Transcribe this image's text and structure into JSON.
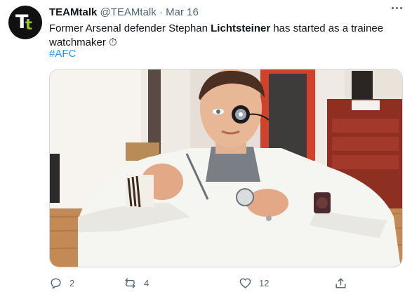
{
  "tweet": {
    "author_name": "TEAMtalk",
    "handle": "@TEAMtalk",
    "separator": "·",
    "date": "Mar 16",
    "avatar_text": "Tt",
    "text_part1": "Former Arsenal defender Stephan ",
    "text_bold": "Lichtsteiner",
    "text_part2": " has started as a trainee watchmaker ",
    "emoji": "⏱",
    "hashtag": "#AFC"
  },
  "actions": {
    "replies": "2",
    "retweets": "4",
    "likes": "12"
  },
  "colors": {
    "link": "#1d9bf0",
    "muted": "#536471",
    "text": "#0f1419",
    "avatar_bg": "#111111",
    "avatar_accent": "#9ac22d"
  },
  "icons": [
    "reply-icon",
    "retweet-icon",
    "like-icon",
    "share-icon",
    "more-icon"
  ]
}
